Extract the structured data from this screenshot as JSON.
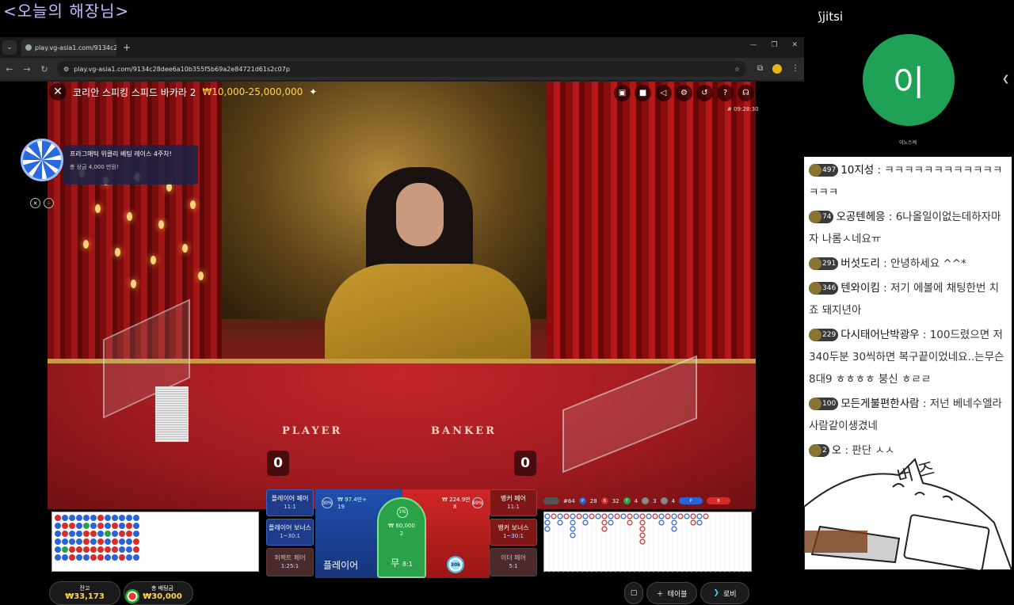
{
  "stream_title": "<오늘의 해장님>",
  "browser": {
    "tab_title": "play.vg-asia1.com/9134c28de",
    "url": "play.vg-asia1.com/9134c28dee6a10b355f5b69a2e84721d61s2c07p"
  },
  "game": {
    "table_name": "코리안 스피킹 스피드 바카라 2",
    "limits": "₩10,000-25,000,000",
    "timer": "# 09:28:30",
    "promo_title": "프라그매틱 위클리 베팅 레이스 4주차!",
    "promo_sub": "총 상금 4,000 만원!",
    "player_label": "PLAYER",
    "banker_label": "BANKER",
    "player_score": "0",
    "banker_score": "0",
    "bets": {
      "player_pair": "플레이어 페어",
      "player_pair_odds": "11:1",
      "player_bonus": "플레이어 보너스",
      "player_bonus_odds": "1~30:1",
      "perfect_pair": "퍼펙트 페어",
      "perfect_pair_odds": "1:25:1",
      "player": "플레이어",
      "player_pct": "30%",
      "player_total": "₩ 97.4만+",
      "player_count": "19",
      "tie": "무",
      "tie_odds": "8:1",
      "tie_pct": "1%",
      "tie_total": "₩ 60,000",
      "tie_count": "2",
      "banker_total": "₩ 224.9만",
      "banker_count": "8",
      "banker_pct": "69%",
      "banker_pair": "뱅커 페어",
      "banker_pair_odds": "11:1",
      "banker_bonus": "뱅커 보너스",
      "banker_bonus_odds": "1~30:1",
      "either_pair": "이더 페어",
      "either_pair_odds": "5:1",
      "chip_value": "30k"
    },
    "stats": {
      "round": "#64",
      "p": "28",
      "b": "32",
      "t": "4",
      "pp": "3",
      "bp": "4"
    },
    "balance_label": "잔고",
    "balance": "₩33,173",
    "total_bet_label": "총 베팅금",
    "total_bet": "₩30,000",
    "table_button": "테이블",
    "lobby_button": "로비"
  },
  "jitsi": {
    "logo": "jitsi",
    "avatar_letter": "이",
    "name": "이노스케"
  },
  "chat": [
    {
      "level": "497",
      "nick": "10지성",
      "text": "ㅋㅋㅋㅋㅋㅋㅋㅋㅋㅋㅋㅋㅋㅋㅋ"
    },
    {
      "level": "74",
      "nick": "오공텐헤응",
      "text": "6나올일이없는데하자마자 나롬ㅅ네요ㅠ"
    },
    {
      "level": "291",
      "nick": "버섯도리",
      "text": "안녕하세요 ^^*"
    },
    {
      "level": "346",
      "nick": "텐와이킴",
      "text": "저기 에볼에 채팅한번 치죠 돼지년아"
    },
    {
      "level": "229",
      "nick": "다시태어난박광우",
      "text": "100드렸으면 저340두분 30씩하면 복구끝이었네요..는무슨 8대9 ㅎㅎㅎㅎ 붕신 ㅎㄹㄹ"
    },
    {
      "level": "100",
      "nick": "모든게불편한사람",
      "text": "저넌 베네수엘라 사람같이생겼네"
    },
    {
      "level": "2",
      "nick": "오",
      "text": "판단 ㅅㅅ"
    }
  ]
}
